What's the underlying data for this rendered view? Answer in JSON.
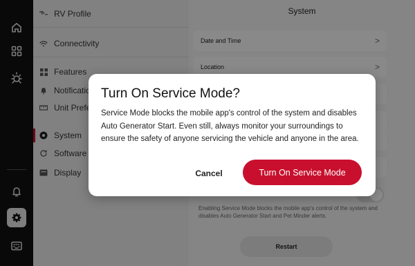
{
  "rail": {
    "icons": [
      "home-icon",
      "grid-icon",
      "sun-icon",
      "bell-icon",
      "gear-icon",
      "keyboard-icon"
    ]
  },
  "nav": {
    "items": [
      {
        "label": "RV Profile",
        "icon": "rv-icon"
      },
      {
        "label": "Connectivity",
        "icon": "wifi-icon"
      },
      {
        "label": "Features",
        "icon": "features-icon"
      },
      {
        "label": "Notificatio",
        "icon": "notification-icon"
      },
      {
        "label": "Unit Prefe",
        "icon": "units-icon"
      },
      {
        "label": "System",
        "icon": "system-icon"
      },
      {
        "label": "Software U",
        "icon": "refresh-icon"
      },
      {
        "label": "Display",
        "icon": "display-icon"
      }
    ]
  },
  "main": {
    "title": "System",
    "rows": [
      {
        "label": "Date and Time"
      },
      {
        "label": "Location"
      }
    ],
    "chevron": ">",
    "helper": "Enabling Service Mode blocks the mobile app's control of the system and disables Auto Generator Start and Pet Minder alerts.",
    "restart_label": "Restart"
  },
  "modal": {
    "title": "Turn On Service Mode?",
    "body": "Service Mode blocks the mobile app's control of the system and disables Auto Generator Start. Even still, always monitor your surroundings to ensure the safety of anyone servicing the vehicle and anyone in the area.",
    "cancel_label": "Cancel",
    "confirm_label": "Turn On Service Mode"
  },
  "colors": {
    "accent": "#c8102e",
    "rail": "#111111"
  }
}
